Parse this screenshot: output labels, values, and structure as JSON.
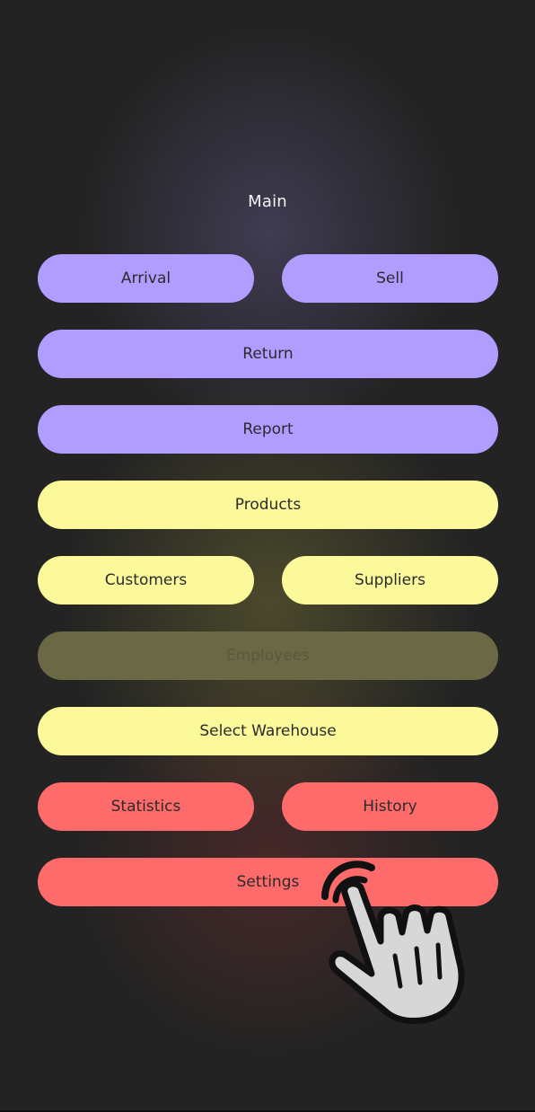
{
  "screen": {
    "title": "Main"
  },
  "buttons": {
    "arrival": "Arrival",
    "sell": "Sell",
    "return": "Return",
    "report": "Report",
    "products": "Products",
    "customers": "Customers",
    "suppliers": "Suppliers",
    "employees": "Employees",
    "select_warehouse": "Select Warehouse",
    "statistics": "Statistics",
    "history": "History",
    "settings": "Settings"
  },
  "states": {
    "employees_disabled": true
  },
  "colors": {
    "background": "#232323",
    "purple": "#b19cff",
    "yellow": "#fcf99a",
    "red": "#ff6b6b",
    "disabled": "#6b6845"
  },
  "overlay": {
    "icon": "pointing-hand-tap-icon"
  }
}
